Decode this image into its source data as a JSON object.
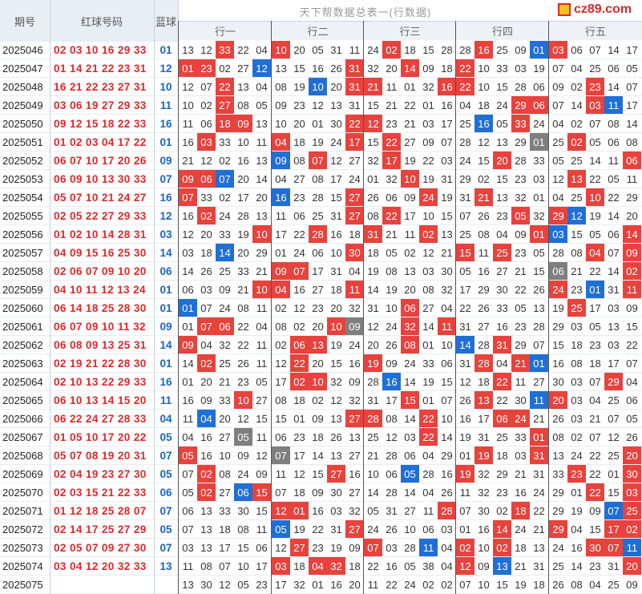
{
  "header": {
    "issue_label": "期号",
    "red_label": "红球号码",
    "blue_label": "蓝球",
    "title": "天下帮数据总表一(行数据)",
    "groups": [
      "行一",
      "行二",
      "行三",
      "行四",
      "行五"
    ]
  },
  "watermark": "cz89.com",
  "colors": {
    "red": "#e8423d",
    "blue": "#1f6fd6",
    "gray": "#7f7f7f"
  },
  "rows": [
    {
      "issue": "2025046",
      "red": "02 03 10 16 29 33",
      "blue": "01",
      "g": [
        "13 12 *33 22 04",
        "*10 20 05 31 11",
        "24 *02 18 15 28",
        "28 *16 25 09 #01",
        "*03 06 07 14 17"
      ]
    },
    {
      "issue": "2025047",
      "red": "01 14 21 22 23 31",
      "blue": "12",
      "g": [
        "*01 *23 02 27 #12",
        "13 15 16 26 *31",
        "32 20 *14 09 18",
        "*22 10 33 03 19",
        "07 04 25 06 05"
      ]
    },
    {
      "issue": "2025048",
      "red": "16 21 22 23 27 31",
      "blue": "10",
      "g": [
        "12 07 *22 13 04",
        "08 19 #10 20 *31",
        "*21 11 01 32 *16",
        "*22 10 15 28 06",
        "09 02 *23 14 07"
      ]
    },
    {
      "issue": "2025049",
      "red": "03 06 19 27 29 33",
      "blue": "11",
      "g": [
        "10 02 *27 08 05",
        "09 23 12 13 31",
        "15 21 22 01 16",
        "04 18 24 *29 *06",
        "07 14 *03 #11 17"
      ]
    },
    {
      "issue": "2025050",
      "red": "09 12 15 18 22 33",
      "blue": "16",
      "g": [
        "11 06 *18 *09 13",
        "10 20 01 30 *22",
        "*12 23 21 03 17",
        "25 #16 05 *33 24",
        "04 02 07 08 14"
      ]
    },
    {
      "issue": "2025051",
      "red": "01 02 03 04 17 22",
      "blue": "01",
      "g": [
        "16 *03 33 10 11",
        "*04 18 19 24 *17",
        "15 *22 27 09 07",
        "28 12 13 29 @01",
        "25 *02 05 06 08"
      ]
    },
    {
      "issue": "2025052",
      "red": "06 07 10 17 20 26",
      "blue": "09",
      "g": [
        "21 12 02 16 13",
        "#09 08 *07 12 27",
        "32 *17 19 22 03",
        "24 15 *20 28 33",
        "05 25 14 11 *06"
      ]
    },
    {
      "issue": "2025053",
      "red": "06 09 10 13 30 33",
      "blue": "07",
      "g": [
        "*09 *06 #07 20 14",
        "04 27 08 17 24",
        "01 32 *10 19 31",
        "29 02 15 23 03",
        "12 *13 22 05 11"
      ]
    },
    {
      "issue": "2025054",
      "red": "05 07 10 21 24 27",
      "blue": "16",
      "g": [
        "*07 33 02 17 20",
        "#16 23 28 15 *27",
        "26 06 09 *24 19",
        "31 *21 13 32 01",
        "04 25 *10 22 29"
      ]
    },
    {
      "issue": "2025055",
      "red": "02 05 22 27 29 33",
      "blue": "12",
      "g": [
        "16 *02 24 28 13",
        "11 06 25 31 *27",
        "08 *22 17 10 15",
        "07 26 23 *05 32",
        "*29 #12 19 14 20"
      ]
    },
    {
      "issue": "2025056",
      "red": "01 02 10 14 28 31",
      "blue": "03",
      "g": [
        "12 20 33 19 *10",
        "17 22 *28 16 18",
        "*31 21 11 *02 13",
        "25 08 04 09 *01",
        "#03 15 05 06 *14"
      ]
    },
    {
      "issue": "2025057",
      "red": "04 09 15 16 25 30",
      "blue": "14",
      "g": [
        "03 18 #14 20 29",
        "01 24 06 10 *30",
        "18 05 02 12 21",
        "*15 11 *25 23 05",
        "28 08 *04 07 *09"
      ]
    },
    {
      "issue": "2025058",
      "red": "02 06 07 09 10 20",
      "blue": "06",
      "g": [
        "14 26 25 33 21",
        "*09 *07 17 31 04",
        "19 08 13 03 30",
        "05 16 27 21 15",
        "@06 21 22 14 *02"
      ]
    },
    {
      "issue": "2025059",
      "red": "04 10 11 12 13 24",
      "blue": "01",
      "g": [
        "06 03 09 21 *10",
        "*04 16 27 18 *11",
        "14 19 20 08 32",
        "17 29 30 22 26",
        "*24 23 #01 31 *11"
      ]
    },
    {
      "issue": "2025060",
      "red": "06 14 18 25 28 30",
      "blue": "01",
      "g": [
        "#01 07 24 08 11",
        "02 12 23 20 32",
        "31 10 *06 27 04",
        "22 26 33 05 13",
        "19 *25 17 03 09"
      ]
    },
    {
      "issue": "2025061",
      "red": "06 07 09 10 11 32",
      "blue": "09",
      "g": [
        "01 *07 *06 22 04",
        "08 02 20 *10 @09",
        "12 24 *32 14 *11",
        "31 27 16 23 28",
        "29 03 05 13 15"
      ]
    },
    {
      "issue": "2025062",
      "red": "06 08 09 13 25 31",
      "blue": "14",
      "g": [
        "*09 04 32 22 11",
        "02 *06 *13 19 24",
        "20 26 *08 01 10",
        "#14 28 *31 29 07",
        "15 18 23 03 22"
      ]
    },
    {
      "issue": "2025063",
      "red": "02 19 21 22 28 30",
      "blue": "01",
      "g": [
        "14 *02 25 26 11",
        "12 *22 20 15 16",
        "*19 09 24 33 06",
        "31 *28 04 *21 #01",
        "16 08 18 17 07"
      ]
    },
    {
      "issue": "2025064",
      "red": "02 10 13 22 29 33",
      "blue": "16",
      "g": [
        "01 20 21 23 05",
        "17 *02 *10 32 09",
        "28 #16 14 19 15",
        "12 18 *22 11 27",
        "30 03 07 *29 04"
      ]
    },
    {
      "issue": "2025065",
      "red": "06 10 13 14 15 20",
      "blue": "11",
      "g": [
        "16 09 33 *10 27",
        "08 18 02 12 32",
        "31 17 *15 01 07",
        "26 *13 22 30 #11",
        "*20 03 04 25 06"
      ]
    },
    {
      "issue": "2025066",
      "red": "06 22 24 27 28 33",
      "blue": "04",
      "g": [
        "11 #04 20 12 15",
        "15 01 09 13 *27",
        "*28 08 14 *22 10",
        "16 17 *06 *24 21",
        "26 03 21 07 05"
      ]
    },
    {
      "issue": "2025067",
      "red": "01 05 10 17 20 22",
      "blue": "05",
      "g": [
        "04 16 27 @05 11",
        "06 23 18 26 13",
        "25 12 03 *22 14",
        "19 31 25 33 *01",
        "08 02 07 12 26"
      ]
    },
    {
      "issue": "2025068",
      "red": "05 07 08 19 20 31",
      "blue": "07",
      "g": [
        "*05 16 10 09 12",
        "@07 17 14 13 27",
        "21 28 06 04 29",
        "01 *19 18 03 *31",
        "13 24 22 25 *20"
      ]
    },
    {
      "issue": "2025069",
      "red": "02 04 19 23 27 30",
      "blue": "05",
      "g": [
        "07 *02 08 24 09",
        "11 12 15 *27 16",
        "10 06 #05 28 16",
        "*19 32 29 21 31",
        "33 *23 22 01 *30"
      ]
    },
    {
      "issue": "2025070",
      "red": "02 03 15 21 22 33",
      "blue": "06",
      "g": [
        "05 *02 27 #06 *15",
        "07 18 09 30 27",
        "14 28 14 04 26",
        "11 32 23 16 24",
        "29 01 *22 15 *03"
      ]
    },
    {
      "issue": "2025071",
      "red": "01 12 18 25 28 07",
      "blue": "07",
      "g": [
        "06 13 33 30 15",
        "*12 *01 16 03 32",
        "05 31 27 11 *28",
        "07 30 02 *18 22",
        "29 19 09 #07 *25"
      ]
    },
    {
      "issue": "2025072",
      "red": "02 14 17 25 27 29",
      "blue": "05",
      "g": [
        "07 13 18 08 11",
        "#05 19 22 31 *27",
        "24 26 10 06 03",
        "01 16 *14 24 21",
        "*29 04 15 *17 *02"
      ]
    },
    {
      "issue": "2025073",
      "red": "02 05 07 09 27 30",
      "blue": "07",
      "g": [
        "03 13 17 15 06",
        "12 *27 23 19 09",
        "*07 03 28 #11 04",
        "*02 10 *02 18 13",
        "24 16 *30 *07 #11"
      ]
    },
    {
      "issue": "2025074",
      "red": "03 04 12 20 32 33",
      "blue": "13",
      "g": [
        "11 08 07 10 17",
        "*03 18 *04 *32 18",
        "22 16 05 38 04",
        "*12 09 #13 21 31",
        "25 14 23 31 *20"
      ]
    },
    {
      "issue": "2025075",
      "red": "",
      "blue": "",
      "g": [
        "13 30 12 05 23",
        "17 32 01 16 20",
        "11 22 24 02 02",
        "07 10 15 19 18",
        "26 08 04 25 09"
      ]
    }
  ]
}
